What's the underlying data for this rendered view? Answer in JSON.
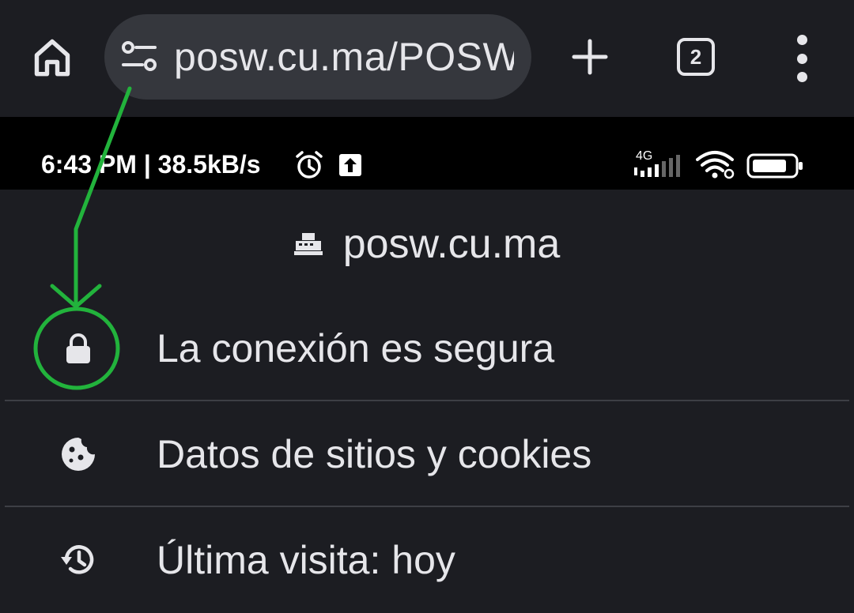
{
  "toolbar": {
    "url": "posw.cu.ma/POSW",
    "tab_count": "2",
    "icons": {
      "home": "home-icon",
      "site_settings": "tune-icon",
      "new_tab": "plus-icon",
      "tabs": "tab-switcher-icon",
      "menu": "more-vert-icon"
    }
  },
  "status_bar": {
    "text": "6:43 PM | 38.5kB/s",
    "network_type": "4G",
    "icons": [
      "alarm-icon",
      "upload-icon",
      "signal-icon",
      "wifi-icon",
      "battery-icon"
    ]
  },
  "page_info": {
    "site": "posw.cu.ma",
    "favicon": "cash-register-icon",
    "rows": [
      {
        "icon": "lock-icon",
        "label": "La conexión es segura"
      },
      {
        "icon": "cookie-icon",
        "label": "Datos de sitios y cookies"
      },
      {
        "icon": "history-icon",
        "label": "Última visita: hoy"
      }
    ]
  },
  "annotation": {
    "color": "#22b33c",
    "shapes": [
      "arrow",
      "circle"
    ]
  }
}
